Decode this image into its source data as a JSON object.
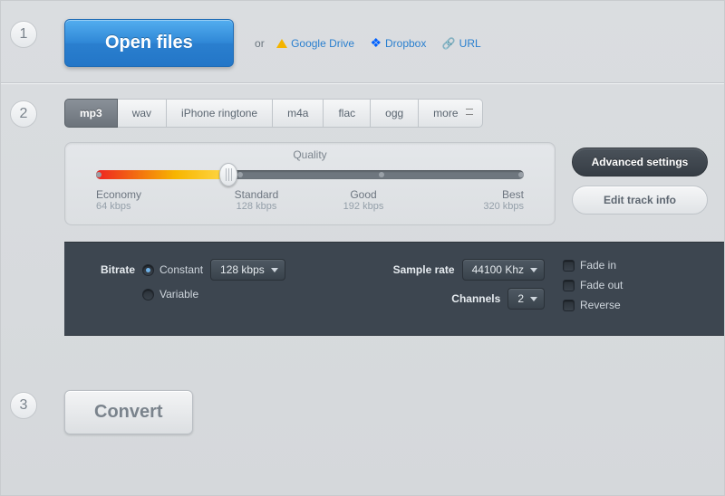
{
  "steps": {
    "s1": "1",
    "s2": "2",
    "s3": "3"
  },
  "open": {
    "button": "Open files",
    "or": "or",
    "gdrive": "Google Drive",
    "dropbox": "Dropbox",
    "url": "URL"
  },
  "tabs": {
    "t0": "mp3",
    "t1": "wav",
    "t2": "iPhone ringtone",
    "t3": "m4a",
    "t4": "flac",
    "t5": "ogg",
    "t6": "more"
  },
  "quality": {
    "title": "Quality",
    "q0": {
      "label": "Economy",
      "sub": "64 kbps"
    },
    "q1": {
      "label": "Standard",
      "sub": "128 kbps"
    },
    "q2": {
      "label": "Good",
      "sub": "192 kbps"
    },
    "q3": {
      "label": "Best",
      "sub": "320 kbps"
    }
  },
  "side": {
    "advanced": "Advanced settings",
    "edit": "Edit track info"
  },
  "adv": {
    "bitrate_label": "Bitrate",
    "constant": "Constant",
    "variable": "Variable",
    "bitrate_value": "128 kbps",
    "samplerate_label": "Sample rate",
    "samplerate_value": "44100 Khz",
    "channels_label": "Channels",
    "channels_value": "2",
    "fadein": "Fade in",
    "fadeout": "Fade out",
    "reverse": "Reverse"
  },
  "convert": "Convert"
}
